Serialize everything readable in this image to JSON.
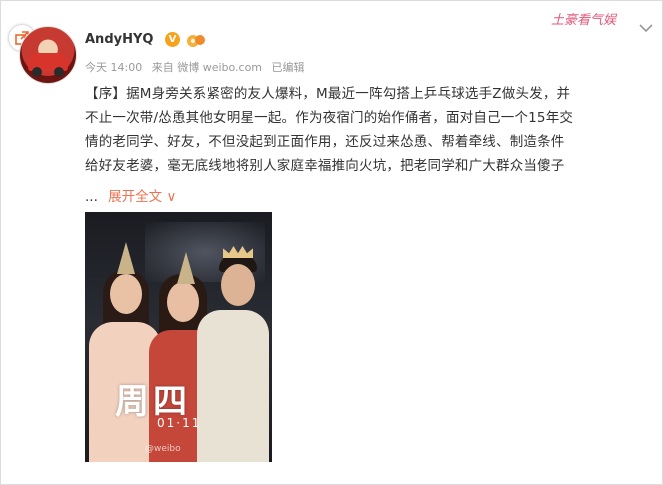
{
  "header": {
    "username": "AndyHYQ",
    "verified_badge": "V",
    "timestamp": "今天 14:00",
    "source": "来自 微博 weibo.com",
    "edited": "已编辑",
    "watermark_text": "土豪看气娱",
    "icons": [
      "share-icon",
      "avatar",
      "verified-icon",
      "medal-icon",
      "chevron-down-icon"
    ]
  },
  "post": {
    "lines": [
      "【序】据M身旁关系紧密的友人爆料，M最近一阵勾搭上乒乓球选手Z做头发，并",
      "不止一次带/怂恿其他女明星一起。作为夜宿门的始作俑者，面对自己一个15年交",
      "情的老同学、好友，不但没起到正面作用，还反过来怂恿、帮着牵线、制造条件",
      "给好友老婆，毫无底线地将别人家庭幸福推向火坑，把老同学和广大群众当傻子"
    ],
    "ellipsis": "...",
    "expand_label": "展开全文",
    "expand_arrow": "∨"
  },
  "photo": {
    "title": "周四",
    "date": "01·11",
    "watermark": "@weibo"
  },
  "colors": {
    "link": "#eb7350",
    "meta": "#999999",
    "badge": "#f7a21b",
    "watermark": "#e05a7a"
  }
}
